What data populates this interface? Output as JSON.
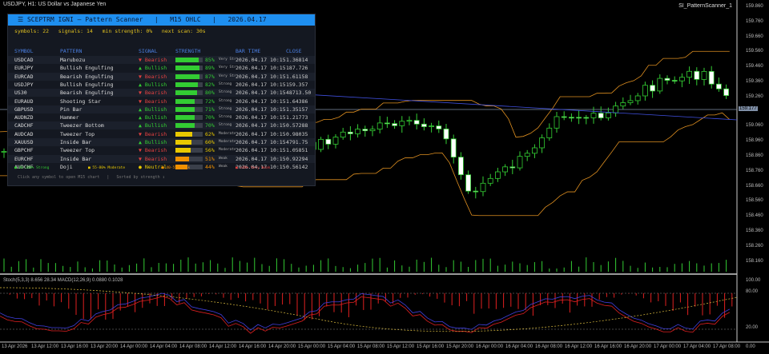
{
  "window": {
    "title": "USDJPY, H1: US Dollar vs Japanese Yen",
    "ea_name": "SI_PatternScanner_1",
    "indicator_label": "Stoch(5,3,3) 8.656 28.34 MACD(12,26,9) 0.0880 0.1028"
  },
  "price_axis": [
    "159.860",
    "159.760",
    "159.660",
    "159.560",
    "159.460",
    "159.360",
    "159.260",
    "159.060",
    "158.960",
    "158.860",
    "158.760",
    "158.660",
    "158.560",
    "158.460",
    "158.360",
    "158.260",
    "158.160"
  ],
  "current_price": "159.177",
  "osc_axis": [
    "100.00",
    "80.00",
    "20.00",
    "0.00"
  ],
  "time_axis": [
    "13 Apr 2026",
    "13 Apr 12:00",
    "13 Apr 16:00",
    "13 Apr 20:00",
    "14 Apr 00:00",
    "14 Apr 04:00",
    "14 Apr 08:00",
    "14 Apr 12:00",
    "14 Apr 16:00",
    "14 Apr 20:00",
    "15 Apr 00:00",
    "15 Apr 04:00",
    "15 Apr 08:00",
    "15 Apr 12:00",
    "15 Apr 16:00",
    "15 Apr 20:00",
    "16 Apr 00:00",
    "16 Apr 04:00",
    "16 Apr 08:00",
    "16 Apr 12:00",
    "16 Apr 16:00",
    "16 Apr 20:00",
    "17 Apr 00:00",
    "17 Apr 04:00",
    "17 Apr 08:00"
  ],
  "scanner": {
    "title": "☰ SCEPTRM IGNI — Pattern Scanner   |   M15 OHLC   |   2026.04.17",
    "stats": "symbols: 22   signals: 14   min strength: 0%   next scan: 30s",
    "headers": {
      "symbol": "SYMBOL",
      "pattern": "PATTERN",
      "signal": "SIGNAL",
      "strength": "STRENGTH",
      "bar_time": "BAR TIME",
      "close": "CLOSE"
    },
    "rows": [
      {
        "symbol": "USDCAD",
        "pattern": "Marubozu",
        "signal": "▼ Bearish",
        "dir": "bear",
        "strength": 85,
        "pct": "85%",
        "label": "Very Strong",
        "time": "2026.04.17 10:15",
        "close": "1.36814"
      },
      {
        "symbol": "EURJPY",
        "pattern": "Bullish Engulfing",
        "signal": "▲ Bullish",
        "dir": "bull",
        "strength": 89,
        "pct": "89%",
        "label": "Very Strong",
        "time": "2026.04.17 10:15",
        "close": "187.726"
      },
      {
        "symbol": "EURCAD",
        "pattern": "Bearish Engulfing",
        "signal": "▼ Bearish",
        "dir": "bear",
        "strength": 87,
        "pct": "87%",
        "label": "Very Strong",
        "time": "2026.04.17 10:15",
        "close": "1.61158"
      },
      {
        "symbol": "USDJPY",
        "pattern": "Bullish Engulfing",
        "signal": "▲ Bullish",
        "dir": "bull",
        "strength": 82,
        "pct": "82%",
        "label": "Strong",
        "time": "2026.04.17 10:15",
        "close": "159.357"
      },
      {
        "symbol": "US30",
        "pattern": "Bearish Engulfing",
        "signal": "▼ Bearish",
        "dir": "bear",
        "strength": 80,
        "pct": "80%",
        "label": "Strong",
        "time": "2026.04.17 10:15",
        "close": "48713.50"
      },
      {
        "symbol": "EURAUD",
        "pattern": "Shooting Star",
        "signal": "▼ Bearish",
        "dir": "bear",
        "strength": 72,
        "pct": "72%",
        "label": "Strong",
        "time": "2026.04.17 10:15",
        "close": "1.64386"
      },
      {
        "symbol": "GBPUSD",
        "pattern": "Pin Bar",
        "signal": "▲ Bullish",
        "dir": "bull",
        "strength": 71,
        "pct": "71%",
        "label": "Strong",
        "time": "2026.04.17 10:15",
        "close": "1.35157"
      },
      {
        "symbol": "AUDNZD",
        "pattern": "Hammer",
        "signal": "▲ Bullish",
        "dir": "bull",
        "strength": 70,
        "pct": "70%",
        "label": "Strong",
        "time": "2026.04.17 10:15",
        "close": "1.21773"
      },
      {
        "symbol": "CADCHF",
        "pattern": "Tweezer Bottom",
        "signal": "▲ Bullish",
        "dir": "bull",
        "strength": 70,
        "pct": "70%",
        "label": "Strong",
        "time": "2026.04.17 10:15",
        "close": "0.57288"
      },
      {
        "symbol": "AUDCAD",
        "pattern": "Tweezer Top",
        "signal": "▼ Bearish",
        "dir": "bear",
        "strength": 62,
        "pct": "62%",
        "label": "Moderate",
        "time": "2026.04.17 10:15",
        "close": "0.98035"
      },
      {
        "symbol": "XAUUSD",
        "pattern": "Inside Bar",
        "signal": "▲ Bullish",
        "dir": "bull",
        "strength": 60,
        "pct": "60%",
        "label": "Moderate",
        "time": "2026.04.17 10:15",
        "close": "4791.75"
      },
      {
        "symbol": "GBPCHF",
        "pattern": "Tweezer Top",
        "signal": "▼ Bearish",
        "dir": "bear",
        "strength": 56,
        "pct": "56%",
        "label": "Moderate",
        "time": "2026.04.17 10:15",
        "close": "1.05851"
      },
      {
        "symbol": "EURCHF",
        "pattern": "Inside Bar",
        "signal": "▼ Bearish",
        "dir": "bear",
        "strength": 51,
        "pct": "51%",
        "label": "Weak",
        "time": "2026.04.17 10:15",
        "close": "0.92294"
      },
      {
        "symbol": "AUDCHF",
        "pattern": "Doji",
        "signal": "● Neutral",
        "dir": "neutral",
        "strength": 44,
        "pct": "44%",
        "label": "Weak",
        "time": "2026.04.17 10:15",
        "close": "0.56142"
      }
    ],
    "legend": [
      {
        "text": "■ 80-100% Strong",
        "color": "#33cc33"
      },
      {
        "text": "■ 55-80% Moderate",
        "color": "#e8c800"
      },
      {
        "text": "■ 40-55% Weak",
        "color": "#f09000"
      },
      {
        "text": "■ <40% Very Weak",
        "color": "#e04040"
      }
    ],
    "footer": "Click any symbol to open M15 chart   |   Sorted by strength ↕"
  },
  "colors": {
    "bull": "#33cc33",
    "bear": "#e04040",
    "neutral": "#e8c800",
    "strong": "#33cc33",
    "moderate": "#e8c800",
    "weak": "#f09000"
  }
}
